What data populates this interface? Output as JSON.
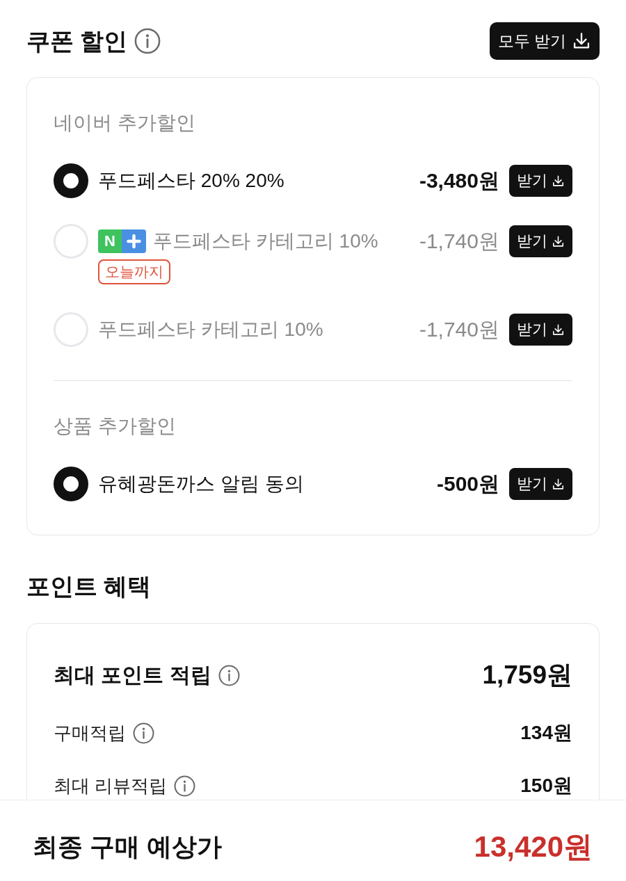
{
  "coupon_section": {
    "title": "쿠폰 할인",
    "download_all_button": "모두 받기",
    "groups": [
      {
        "title": "네이버 추가할인",
        "coupons": [
          {
            "name": "푸드페스타 20% 20%",
            "amount": "-3,480원",
            "button": "받기",
            "selected": true
          },
          {
            "badge": "N",
            "name": "푸드페스타 카테고리 10%",
            "tag": "오늘까지",
            "amount": "-1,740원",
            "button": "받기",
            "selected": false
          },
          {
            "name": "푸드페스타 카테고리 10%",
            "amount": "-1,740원",
            "button": "받기",
            "selected": false
          }
        ]
      },
      {
        "title": "상품 추가할인",
        "coupons": [
          {
            "name": "유혜광돈까스 알림 동의",
            "amount": "-500원",
            "button": "받기",
            "selected": true
          }
        ]
      }
    ]
  },
  "point_section": {
    "title": "포인트 혜택",
    "rows": [
      {
        "kind": "total",
        "label": "최대 포인트 적립",
        "value": "1,759원"
      },
      {
        "kind": "detail",
        "label": "구매적립",
        "value": "134원"
      },
      {
        "kind": "detail",
        "label": "최대 리뷰적립",
        "value": "150원"
      }
    ]
  },
  "footer": {
    "label": "최종 구매 예상가",
    "value": "13,420원"
  }
}
